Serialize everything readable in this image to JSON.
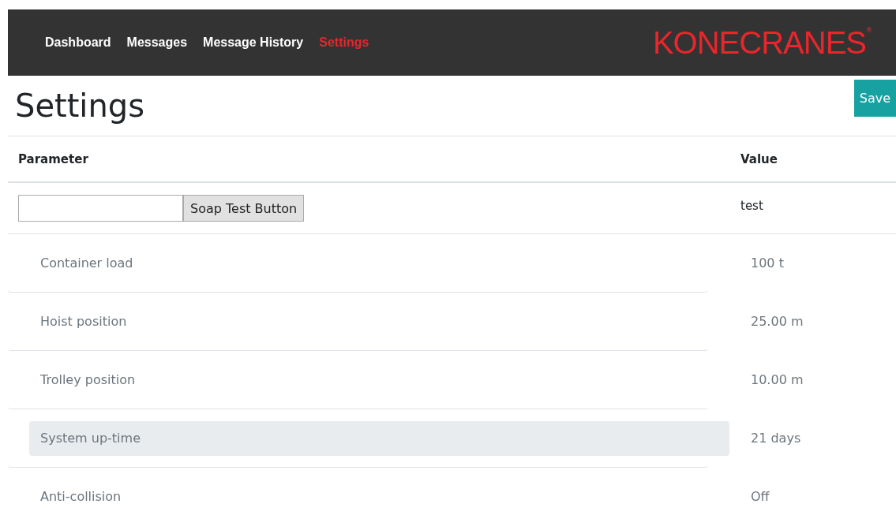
{
  "nav": {
    "links": [
      {
        "label": "Dashboard",
        "selected": false
      },
      {
        "label": "Messages",
        "selected": false
      },
      {
        "label": "Message History",
        "selected": false
      },
      {
        "label": "Settings",
        "selected": true
      }
    ],
    "logo": {
      "text": "KONECRANES",
      "mark": "®"
    }
  },
  "page": {
    "title": "Settings",
    "save_button": "Save"
  },
  "table": {
    "columns": [
      "Parameter",
      "Value"
    ],
    "rows": [
      {
        "kind": "soap",
        "button": "Soap Test Button",
        "value": "test"
      },
      {
        "kind": "param",
        "parameter": "Container load",
        "value": "100 t",
        "highlighted": false
      },
      {
        "kind": "param",
        "parameter": "Hoist position",
        "value": "25.00 m",
        "highlighted": false
      },
      {
        "kind": "param",
        "parameter": "Trolley position",
        "value": "10.00 m",
        "highlighted": false
      },
      {
        "kind": "param",
        "parameter": "System up-time",
        "value": "21 days",
        "highlighted": true
      },
      {
        "kind": "param",
        "parameter": "Anti-collision",
        "value": "Off",
        "highlighted": false
      }
    ]
  }
}
